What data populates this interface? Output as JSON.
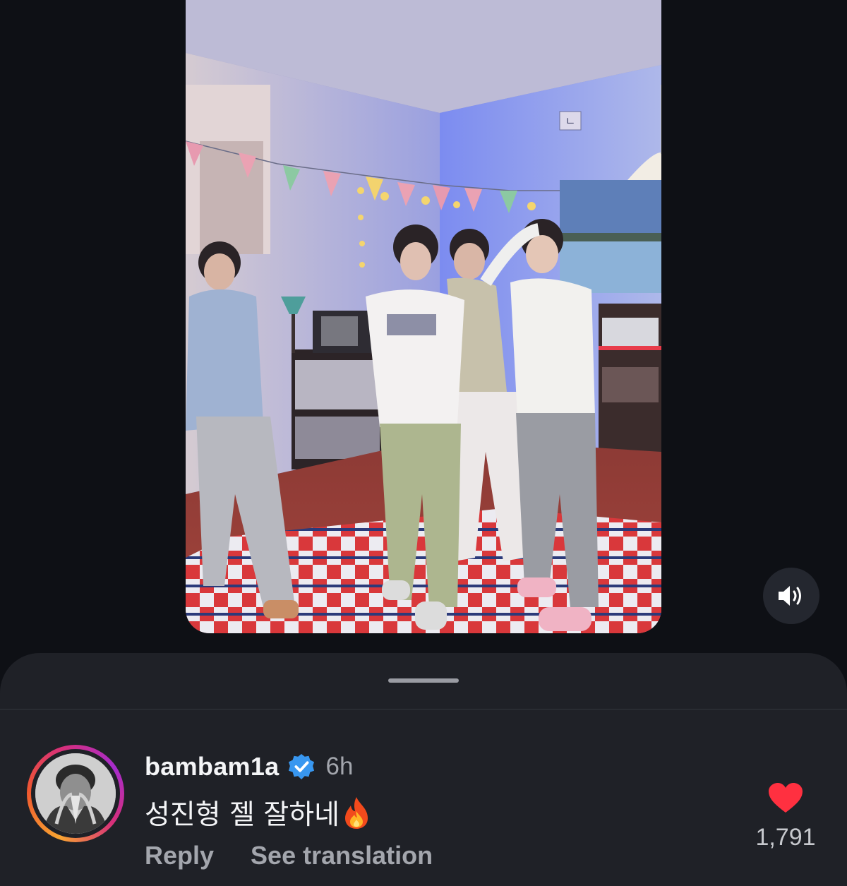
{
  "video": {
    "sound_icon": "speaker-on-icon",
    "sticker_text": "ㄴ"
  },
  "comment": {
    "username": "bambam1a",
    "verified_icon": "verified-badge-icon",
    "time": "6h",
    "text": "성진형 젤 잘하네",
    "emoji_icon": "fire-emoji-icon",
    "reply_label": "Reply",
    "translate_label": "See translation",
    "like_icon": "heart-icon",
    "like_count": "1,791",
    "like_color": "#ff3040"
  },
  "colors": {
    "background": "#0e1015",
    "sheet": "#1f2127",
    "secondary_text": "#a3a6ad",
    "verified_blue": "#3897f0"
  }
}
